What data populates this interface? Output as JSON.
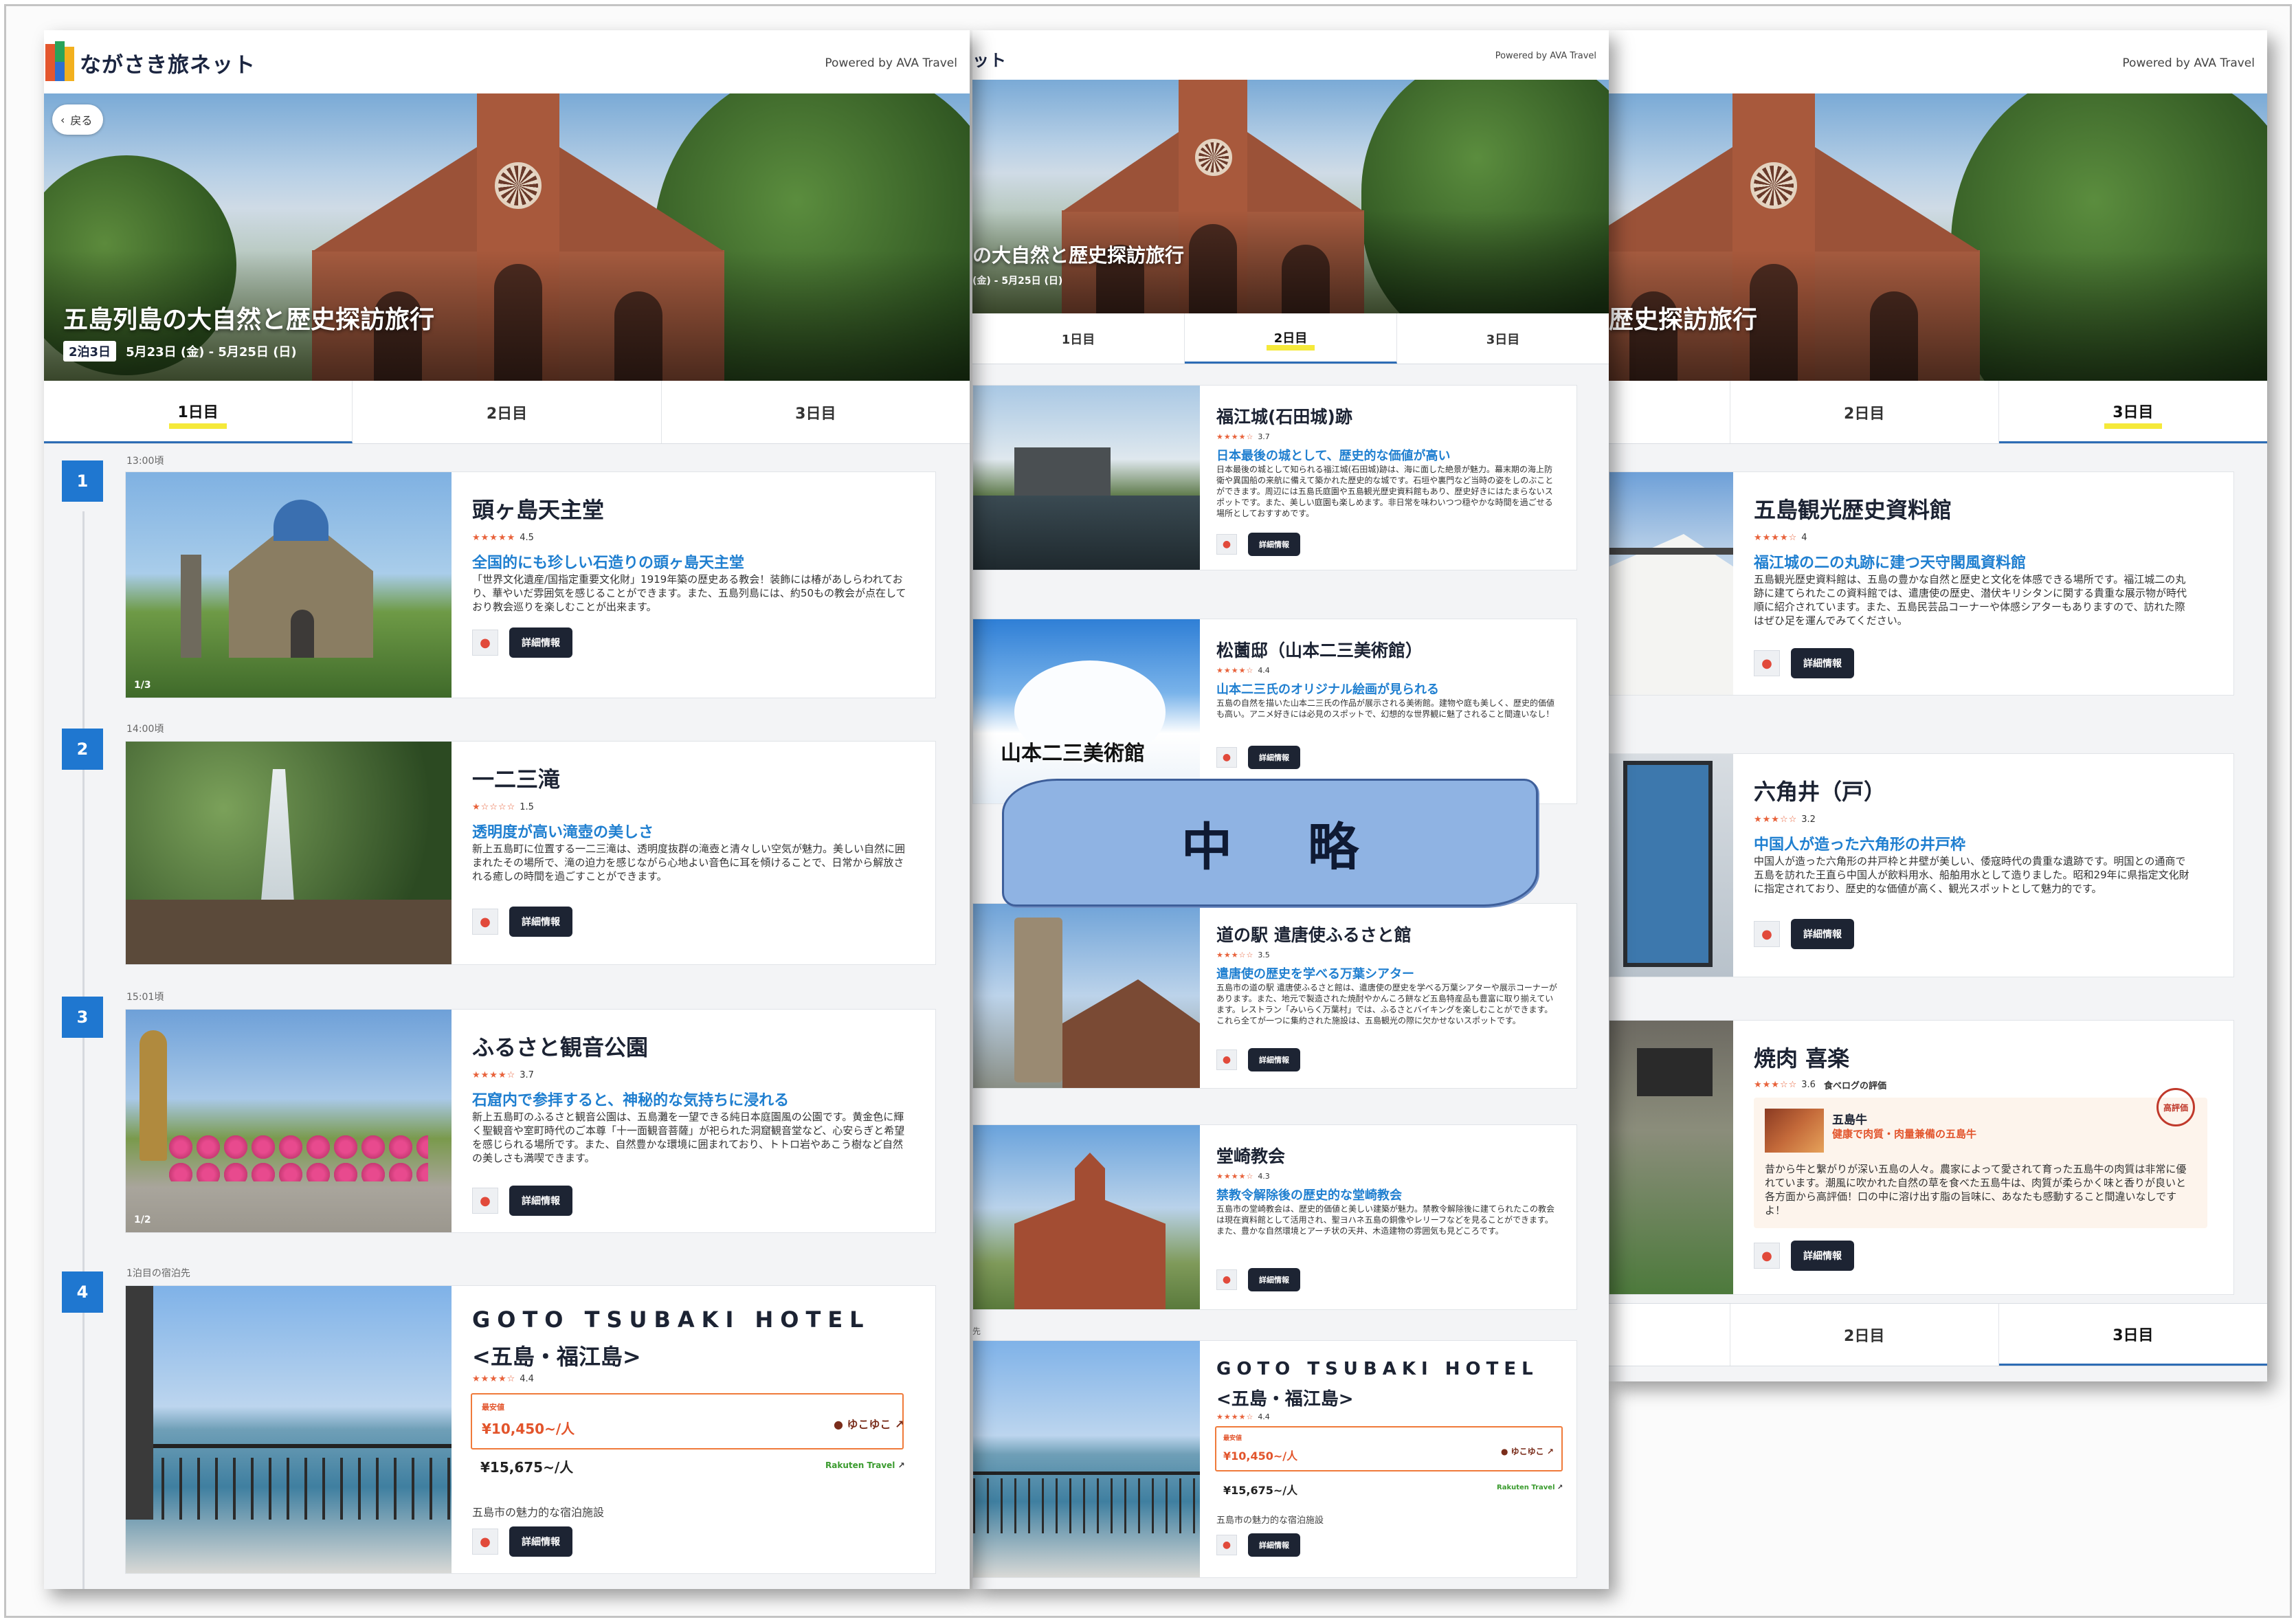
{
  "app": {
    "logo_text": "ながさき旅ネット",
    "powered": "Powered by AVA Travel"
  },
  "trip": {
    "title": "五島列島の大自然と歴史探訪旅行",
    "nights": "2泊3日",
    "dates": "5月23日 (金) - 5月25日 (日)",
    "back_label": "戻る",
    "p2_title_visible": "の大自然と歴史探訪旅行",
    "p2_dates_visible": "(金) - 5月25日 (日)",
    "p3_title_visible": "歴史探訪旅行"
  },
  "tabs": [
    "1日目",
    "2日目",
    "3日目"
  ],
  "labels": {
    "detail": "詳細情報",
    "cheapest": "最安値",
    "tabelog": "食べログの評価",
    "hotel_note": "五島市の魅力的な宿泊施設",
    "lodging_caption": "1泊目の宿泊先"
  },
  "banner": [
    "中",
    "略"
  ],
  "day1": [
    {
      "step": "1",
      "time": "13:00頃",
      "name": "頭ヶ島天主堂",
      "rating": "4.5",
      "stars": "★★★★★",
      "catch": "全国的にも珍しい石造りの頭ヶ島天主堂",
      "desc": "「世界文化遺産/国指定重要文化財」1919年築の歴史ある教会！装飾には椿があしらわれており、華やいだ雰囲気を感じることができます。また、五島列島には、約50もの教会が点在しており教会巡りを楽しむことが出来ます。",
      "count": "1/3"
    },
    {
      "step": "2",
      "time": "14:00頃",
      "name": "一二三滝",
      "rating": "1.5",
      "stars": "★☆☆☆☆",
      "catch": "透明度が高い滝壺の美しさ",
      "desc": "新上五島町に位置する一二三滝は、透明度抜群の滝壺と清々しい空気が魅力。美しい自然に囲まれたその場所で、滝の迫力を感じながら心地よい音色に耳を傾けることで、日常から解放される癒しの時間を過ごすことができます。"
    },
    {
      "step": "3",
      "time": "15:01頃",
      "name": "ふるさと観音公園",
      "rating": "3.7",
      "stars": "★★★★☆",
      "catch": "石窟内で参拝すると、神秘的な気持ちに浸れる",
      "desc": "新上五島町のふるさと観音公園は、五島灘を一望できる純日本庭園風の公園です。黄金色に輝く聖観音や室町時代のご本尊「十一面観音菩薩」が祀られた洞窟観音堂など、心安らぎと希望を感じられる場所です。また、自然豊かな環境に囲まれており、トトロ岩やあこう樹など自然の美しさも満喫できます。",
      "count": "1/2"
    },
    {
      "step": "4",
      "time": "1泊目の宿泊先",
      "name": "GOTO TSUBAKI HOTEL",
      "name2": "<五島・福江島>",
      "rating": "4.4",
      "stars": "★★★★☆",
      "price1": "¥10,450~/人",
      "vendor1": "ゆこゆこ",
      "price2": "¥15,675~/人",
      "vendor2": "Rakuten Travel"
    }
  ],
  "day2": [
    {
      "name": "福江城(石田城)跡",
      "rating": "3.7",
      "stars": "★★★★☆",
      "catch": "日本最後の城として、歴史的な価値が高い",
      "desc": "日本最後の城として知られる福江城(石田城)跡は、海に面した絶景が魅力。幕末期の海上防衛や異国船の来航に備えて築かれた歴史的な城です。石垣や裏門など当時の姿をしのぶことができます。周辺には五島氏庭園や五島観光歴史資料館もあり、歴史好きにはたまらないスポットです。また、美しい庭園も楽しめます。非日常を味わいつつ穏やかな時間を過ごせる場所としておすすめです。"
    },
    {
      "name": "松薗邸（山本二三美術館）",
      "rating": "4.4",
      "stars": "★★★★☆",
      "catch": "山本二三氏のオリジナル絵画が見られる",
      "desc": "五島の自然を描いた山本二三氏の作品が展示される美術館。建物や庭も美しく、歴史的価値も高い。アニメ好きには必見のスポットで、幻想的な世界観に魅了されること間違いなし！",
      "sign": "山本二三美術館"
    },
    {
      "name": "道の駅 遣唐使ふるさと館",
      "rating": "3.5",
      "stars": "★★★☆☆",
      "catch": "遣唐使の歴史を学べる万葉シアター",
      "desc": "五島市の道の駅 遣唐使ふるさと館は、遣唐使の歴史を学べる万葉シアターや展示コーナーがあります。また、地元で製造された焼酎やかんころ餅など五島特産品も豊富に取り揃えています。レストラン「みいらく万葉村」では、ふるさとバイキングを楽しむことができます。これら全てが一つに集約された施設は、五島観光の際に欠かせないスポットです。"
    },
    {
      "name": "堂崎教会",
      "rating": "4.3",
      "stars": "★★★★☆",
      "catch": "禁教令解除後の歴史的な堂崎教会",
      "desc": "五島市の堂崎教会は、歴史的価値と美しい建築が魅力。禁教令解除後に建てられたこの教会は現在資料館として活用され、聖ヨハネ五島の銅像やレリーフなどを見ることができます。また、豊かな自然環境とアーチ状の天井、木造建物の雰囲気も見どころです。"
    },
    {
      "name": "GOTO TSUBAKI HOTEL",
      "name2": "<五島・福江島>",
      "rating": "4.4",
      "stars": "★★★★☆",
      "price1": "¥10,450~/人",
      "vendor1": "ゆこゆこ",
      "price2": "¥15,675~/人",
      "vendor2": "Rakuten Travel",
      "time_fragment": "先"
    }
  ],
  "day3": [
    {
      "name": "五島観光歴史資料館",
      "rating": "4",
      "stars": "★★★★☆",
      "catch": "福江城の二の丸跡に建つ天守閣風資料館",
      "desc": "五島観光歴史資料館は、五島の豊かな自然と歴史と文化を体感できる場所です。福江城二の丸跡に建てられたこの資料館では、遣唐使の歴史、潜伏キリシタンに関する貴重な展示物が時代順に紹介されています。また、五島民芸品コーナーや体感シアターもありますので、訪れた際はぜひ足を運んでみてください。"
    },
    {
      "name": "六角井（戸）",
      "rating": "3.2",
      "stars": "★★★☆☆",
      "catch": "中国人が造った六角形の井戸枠",
      "desc": "中国人が造った六角形の井戸枠と井壁が美しい、倭寇時代の貴重な遺跡です。明国との通商で五島を訪れた王直ら中国人が飲料用水、船舶用水として造りました。昭和29年に県指定文化財に指定されており、歴史的な価値が高く、観光スポットとして魅力的です。"
    },
    {
      "name": "焼肉 喜楽",
      "rating": "3.6",
      "stars": "★★★☆☆",
      "bubble_title": "五島牛",
      "bubble_sub": "健康で肉質・肉量兼備の五島牛",
      "desc": "昔から牛と繋がりが深い五島の人々。農家によって愛されて育った五島牛の肉質は非常に優れています。潮風に吹かれた自然の草を食べた五島牛は、肉質が柔らかく味と香りが良いと各方面から高評価！口の中に溶け出す脂の旨味に、あなたも感動すること間違いなしですよ！",
      "seal": "高評価"
    }
  ]
}
